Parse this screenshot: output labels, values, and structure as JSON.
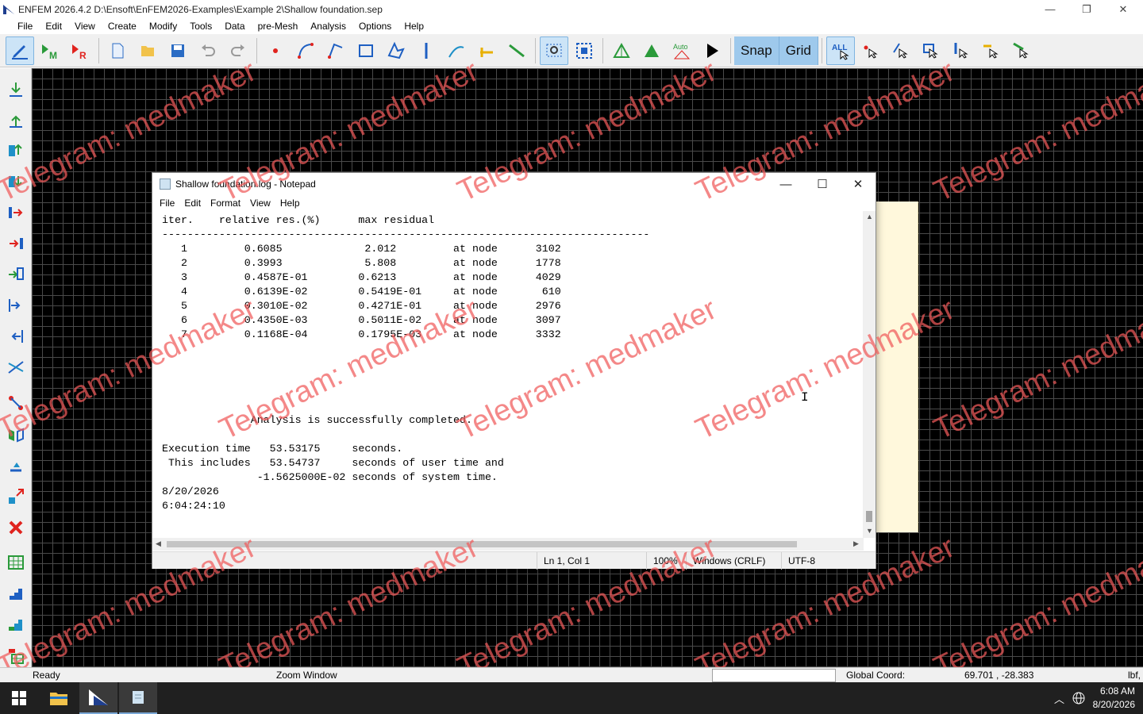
{
  "window": {
    "title": "ENFEM 2026.4.2  D:\\Ensoft\\EnFEM2026-Examples\\Example 2\\Shallow foundation.sep",
    "minimize": "—",
    "restore": "❐",
    "close": "✕"
  },
  "menu": [
    "File",
    "Edit",
    "View",
    "Create",
    "Modify",
    "Tools",
    "Data",
    "pre-Mesh",
    "Analysis",
    "Options",
    "Help"
  ],
  "toolbar": {
    "snap_label": "Snap",
    "grid_label": "Grid",
    "all_label": "ALL",
    "auto_label": "Auto",
    "m_label": "M",
    "r_label": "R"
  },
  "notepad": {
    "title": "Shallow foundation.log - Notepad",
    "menu": [
      "File",
      "Edit",
      "Format",
      "View",
      "Help"
    ],
    "content": "iter.    relative res.(%)      max residual\n-----------------------------------------------------------------------------\n   1         0.6085             2.012         at node      3102\n   2         0.3993             5.808         at node      1778\n   3         0.4587E-01        0.6213         at node      4029\n   4         0.6139E-02        0.5419E-01     at node       610\n   5         0.3010E-02        0.4271E-01     at node      2976\n   6         0.4350E-03        0.5011E-02     at node      3097\n   7         0.1168E-04        0.1795E-03     at node      3332\n\n\n\n\n\n              Analysis is successfully completed.\n\nExecution time   53.53175     seconds.\n This includes   53.54737     seconds of user time and\n               -1.5625000E-02 seconds of system time.\n8/20/2026\n6:04:24:10",
    "status": {
      "position": "Ln 1, Col 1",
      "zoom": "100%",
      "line_ending": "Windows (CRLF)",
      "encoding": "UTF-8"
    }
  },
  "statusbar": {
    "ready": "Ready",
    "mode": "Zoom Window",
    "coord_label": "Global Coord:",
    "coord_value": "69.701 , -28.383",
    "unit": "lbf,"
  },
  "taskbar": {
    "time": "6:08 AM",
    "date": "8/20/2026"
  },
  "watermark": "Telegram: medmaker",
  "colors": {
    "accent_blue": "#1e5fc2",
    "accent_red": "#e0231e",
    "accent_green": "#2a9a3a",
    "canvas": "#000000",
    "watermark": "#f05a5a"
  }
}
